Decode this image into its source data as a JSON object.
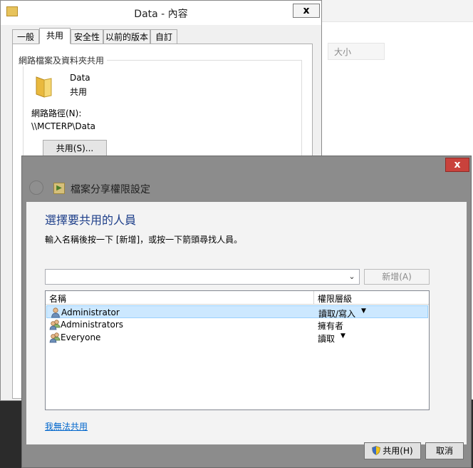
{
  "explorer": {
    "col_size": "大小"
  },
  "properties": {
    "title": "Data - 內容",
    "close_label": "x",
    "tabs": [
      {
        "label": "一般"
      },
      {
        "label": "共用"
      },
      {
        "label": "安全性"
      },
      {
        "label": "以前的版本"
      },
      {
        "label": "自訂"
      }
    ],
    "group_label": "網路檔案及資料夾共用",
    "folder_name": "Data",
    "folder_state": "共用",
    "netpath_label": "網路路徑(N):",
    "netpath_value": "\\\\MCTERP\\Data",
    "share_button": "共用(S)..."
  },
  "share_dialog": {
    "title": "檔案分享權限設定",
    "close_label": "x",
    "heading": "選擇要共用的人員",
    "instruction": "輸入名稱後按一下 [新增]，或按一下箭頭尋找人員。",
    "name_input_value": "",
    "add_button": "新增(A)",
    "columns": {
      "name": "名稱",
      "permission": "權限層級"
    },
    "rows": [
      {
        "name": "Administrator",
        "permission": "讀取/寫入",
        "has_dropdown": true,
        "selected": true
      },
      {
        "name": "Administrators",
        "permission": "擁有者",
        "has_dropdown": false,
        "selected": false
      },
      {
        "name": "Everyone",
        "permission": "讀取",
        "has_dropdown": true,
        "selected": false
      }
    ],
    "cant_share_link": "我無法共用",
    "share_button": "共用(H)",
    "cancel_button": "取消"
  }
}
